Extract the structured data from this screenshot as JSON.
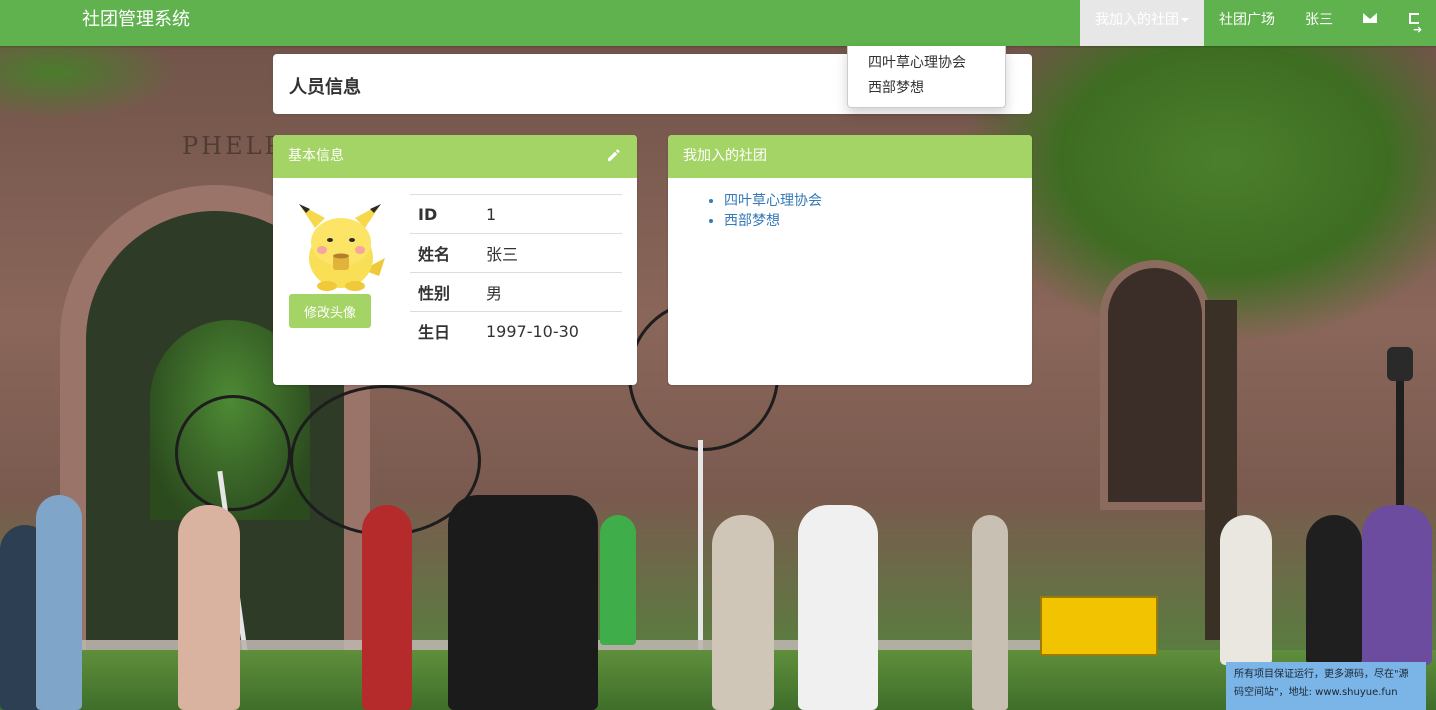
{
  "app": {
    "brand": "社团管理系统"
  },
  "nav": {
    "my_clubs": "我加入的社团",
    "club_square": "社团广场",
    "user": "张三",
    "mail_icon": "envelope-icon",
    "logout_icon": "logout-icon"
  },
  "dropdown": {
    "items": [
      "四叶草心理协会",
      "西部梦想"
    ]
  },
  "page": {
    "title": "人员信息"
  },
  "basic_info": {
    "heading": "基本信息",
    "edit_icon": "pencil-icon",
    "avatar_button": "修改头像",
    "rows": [
      {
        "key": "ID",
        "value": "1"
      },
      {
        "key": "姓名",
        "value": "张三"
      },
      {
        "key": "性别",
        "value": "男"
      },
      {
        "key": "生日",
        "value": "1997-10-30"
      }
    ]
  },
  "clubs": {
    "heading": "我加入的社团",
    "items": [
      "四叶草心理协会",
      "西部梦想"
    ]
  },
  "background": {
    "building_sign": "PHELPS"
  },
  "footer_note": "所有项目保证运行，更多源码，尽在\"源码空间站\"，地址: www.shuyue.fun",
  "colors": {
    "navbar": "#5fb24d",
    "panel_heading": "#a4d466",
    "link": "#337ab7"
  }
}
